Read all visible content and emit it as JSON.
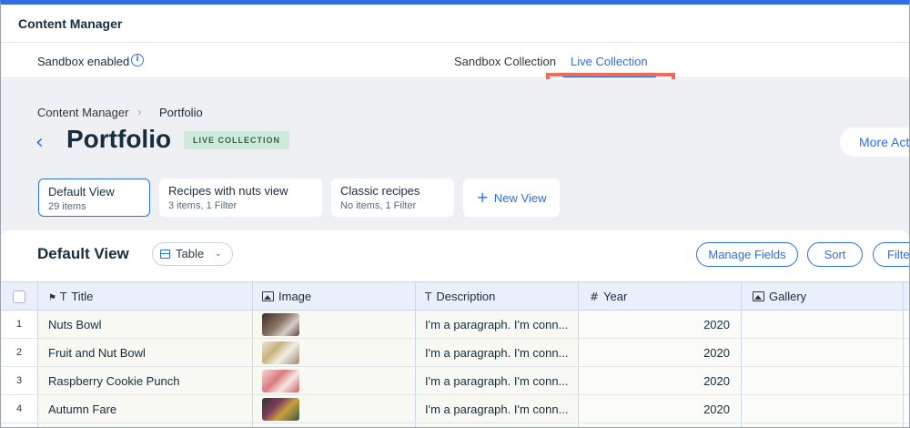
{
  "app": {
    "title": "Content Manager"
  },
  "tabbar": {
    "sandbox_label": "Sandbox enabled",
    "tabs": [
      {
        "label": "Sandbox Collection",
        "active": false
      },
      {
        "label": "Live Collection",
        "active": true
      }
    ]
  },
  "breadcrumb": [
    "Content Manager",
    "Portfolio"
  ],
  "page": {
    "title": "Portfolio",
    "badge": "LIVE COLLECTION",
    "more_actions": "More Actions"
  },
  "views": [
    {
      "name": "Default View",
      "sub": "29 items",
      "active": true
    },
    {
      "name": "Recipes with nuts view",
      "sub": "3 items, 1 Filter",
      "active": false
    },
    {
      "name": "Classic recipes",
      "sub": "No items, 1 Filter",
      "active": false
    }
  ],
  "new_view_label": "New View",
  "table_panel": {
    "title": "Default View",
    "layout": "Table",
    "buttons": {
      "manage_fields": "Manage Fields",
      "sort": "Sort",
      "filter": "Filter"
    }
  },
  "columns": [
    {
      "label": "Title",
      "icon": "text-type-icon"
    },
    {
      "label": "Image",
      "icon": "image-icon"
    },
    {
      "label": "Description",
      "icon": "text-type-icon"
    },
    {
      "label": "Year",
      "icon": "number-icon"
    },
    {
      "label": "Gallery",
      "icon": "gallery-icon"
    }
  ],
  "rows": [
    {
      "num": "1",
      "title": "Nuts Bowl",
      "description": "I'm a paragraph. I'm conn...",
      "year": "2020"
    },
    {
      "num": "2",
      "title": "Fruit and Nut Bowl",
      "description": "I'm a paragraph. I'm conn...",
      "year": "2020"
    },
    {
      "num": "3",
      "title": "Raspberry Cookie Punch",
      "description": "I'm a paragraph. I'm conn...",
      "year": "2020"
    },
    {
      "num": "4",
      "title": "Autumn Fare",
      "description": "I'm a paragraph. I'm conn...",
      "year": "2020"
    }
  ],
  "colors": {
    "accent": "#2b6ee6",
    "highlight": "#f06c58",
    "badge_bg": "#cfeadb"
  }
}
